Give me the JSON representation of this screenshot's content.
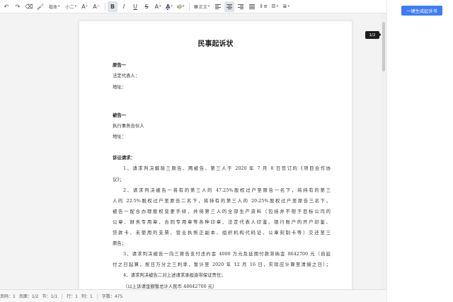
{
  "toolbar": {
    "font_name": "楷体",
    "font_size": "小二",
    "grow_icon": "A⁺",
    "shrink_icon": "A⁻",
    "bold": "B",
    "italic": "I",
    "underline": "U",
    "strike": "S",
    "font_color_letter": "A",
    "highlight_letter": "ab",
    "style_name": "正文",
    "active_color": "#dfe3ea"
  },
  "page_indicator": "1/2",
  "generate_button": "一键生成起诉书",
  "document": {
    "title": "民事起诉状",
    "plaintiff_heading": "原告一",
    "plaintiff_rep": "法定代表人：",
    "plaintiff_address": "地址：",
    "defendant_heading": "被告一",
    "defendant_partner": "执行事务合伙人",
    "defendant_address": "地址：",
    "claims_heading": "诉讼请求：",
    "lines": [
      "1、请求判决解除三原告、两被告、第三人于 2020 年 7 月 8 日签订的《项目合作协",
      "议》；",
      "2、请求判决被告一将有的第三人的 47.25%股权过户至原告一名下，将持有的第三",
      "人的 22.5%股权过户至原告二名下，将持有的第三人的 20.25%股权过户至原告三名下，",
      "被告一配合办理股权变更手续，并将第三人的全部生产资料（包括并不限于目标公司的",
      "公章、财务专用章、合同专用章等各种印章、法定代表人印鉴、银行账户的开户印鉴、",
      "贷款卡、未使用的支票、营业执照正副本、组织机构代码证、公章刻制卡等）交还至三",
      "原告；",
      "3、请求判决被告一向三原告支付违约金 4000 万元及延期付款滞纳金 8642700 元（自延",
      "付之日起算，按日万分之三利率，暂计至 2020 年 12 月 16 日，实际应计算至清偿之日）；",
      "4、请求判决被告二对上述请求承担连带保证责任；",
      "（以上诉请金额暂总计人民币 48642700 元）"
    ]
  },
  "status": {
    "page_index": "页码：1",
    "pages": "页面：1/2",
    "section": "节：1/1",
    "row": "行：1",
    "col": "列：1",
    "words": "字数：475"
  },
  "colors": {
    "accent": "#3d7cf6",
    "font_color_bar": "#2b6ee6",
    "highlight_bar": "#f7d21b"
  }
}
